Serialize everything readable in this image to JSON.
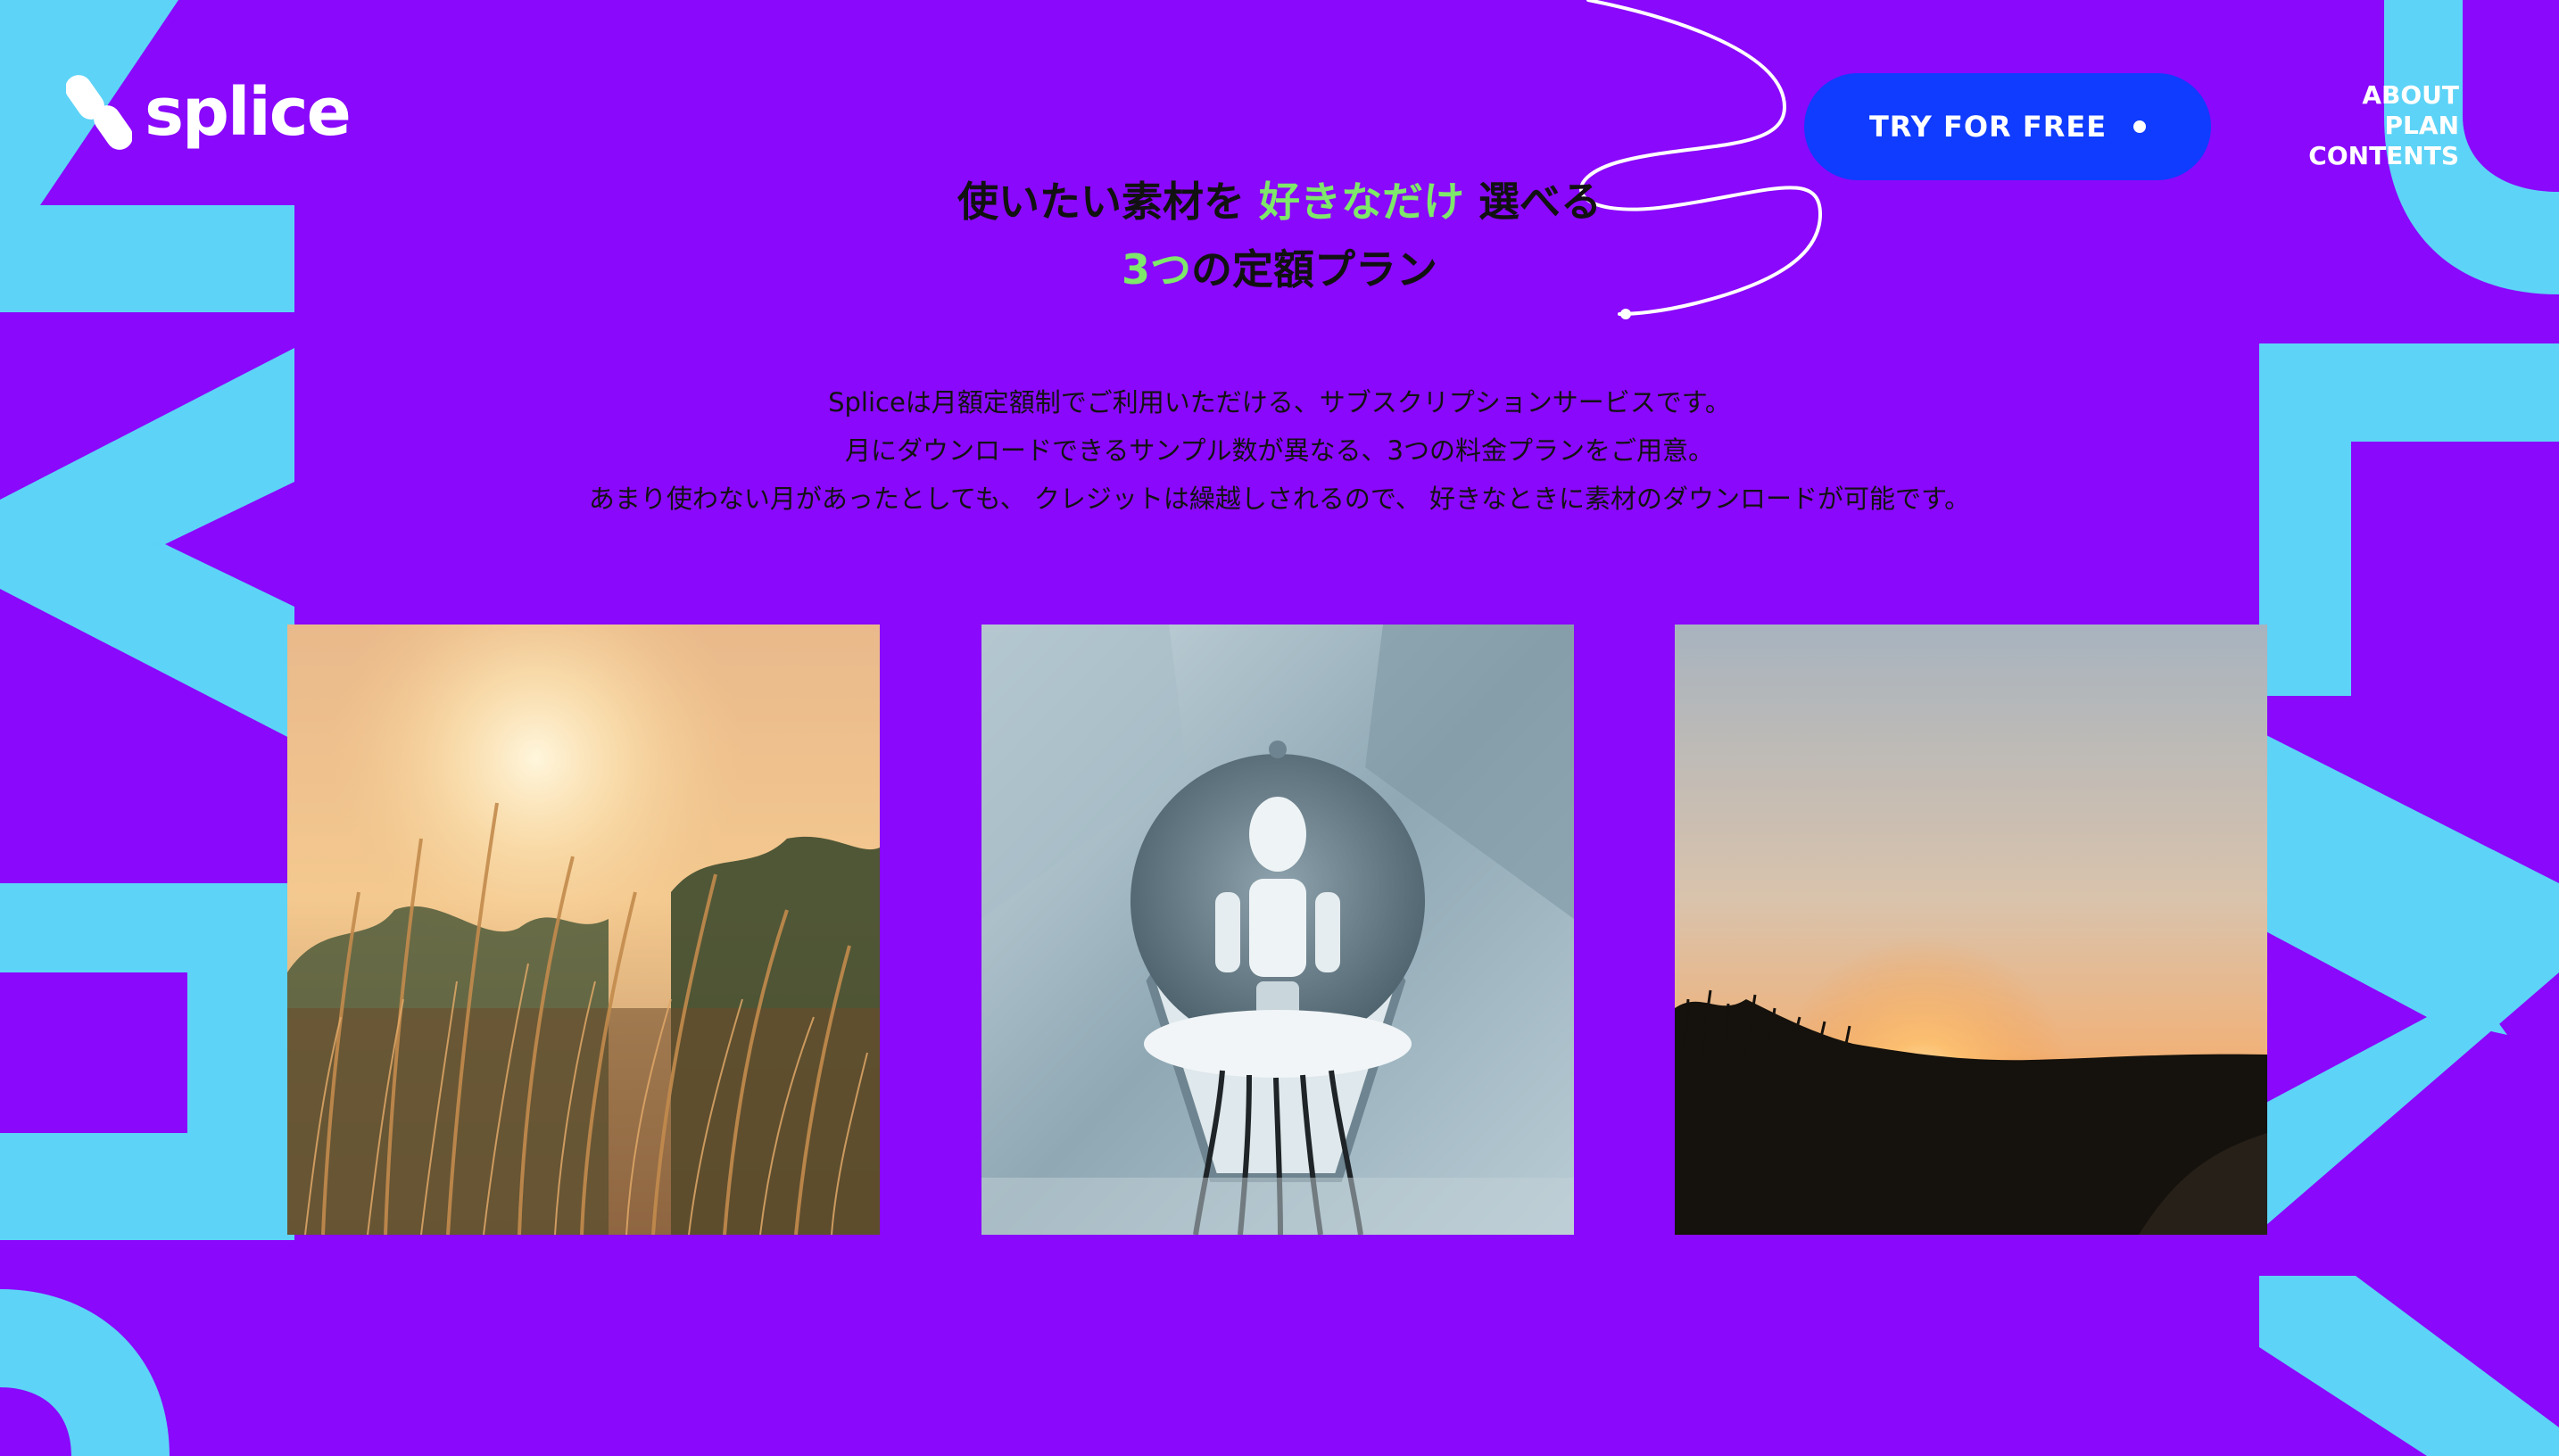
{
  "brand": {
    "name": "splice"
  },
  "header": {
    "cta_label": "TRY FOR FREE",
    "nav": [
      "ABOUT",
      "PLAN",
      "CONTENTS"
    ]
  },
  "headline": {
    "line1_part1": "使いたい素材を ",
    "line1_accent": "好きなだけ",
    "line1_part2": " 選べる",
    "line2_accent": "3つ",
    "line2_part": "の定額プラン"
  },
  "description": [
    "Spliceは月額定額制でご利用いただける、サブスクリプションサービスです。",
    "月にダウンロードできるサンプル数が異なる、3つの料金プランをご用意。",
    "あまり使わない月があったとしても、 クレジットは繰越しされるので、 好きなときに素材のダウンロードが可能です。"
  ],
  "colors": {
    "background": "#8a08fb",
    "accent_text": "#7ee86a",
    "deco_letters": "#5dd3f7",
    "cta": "#0f3cff"
  }
}
